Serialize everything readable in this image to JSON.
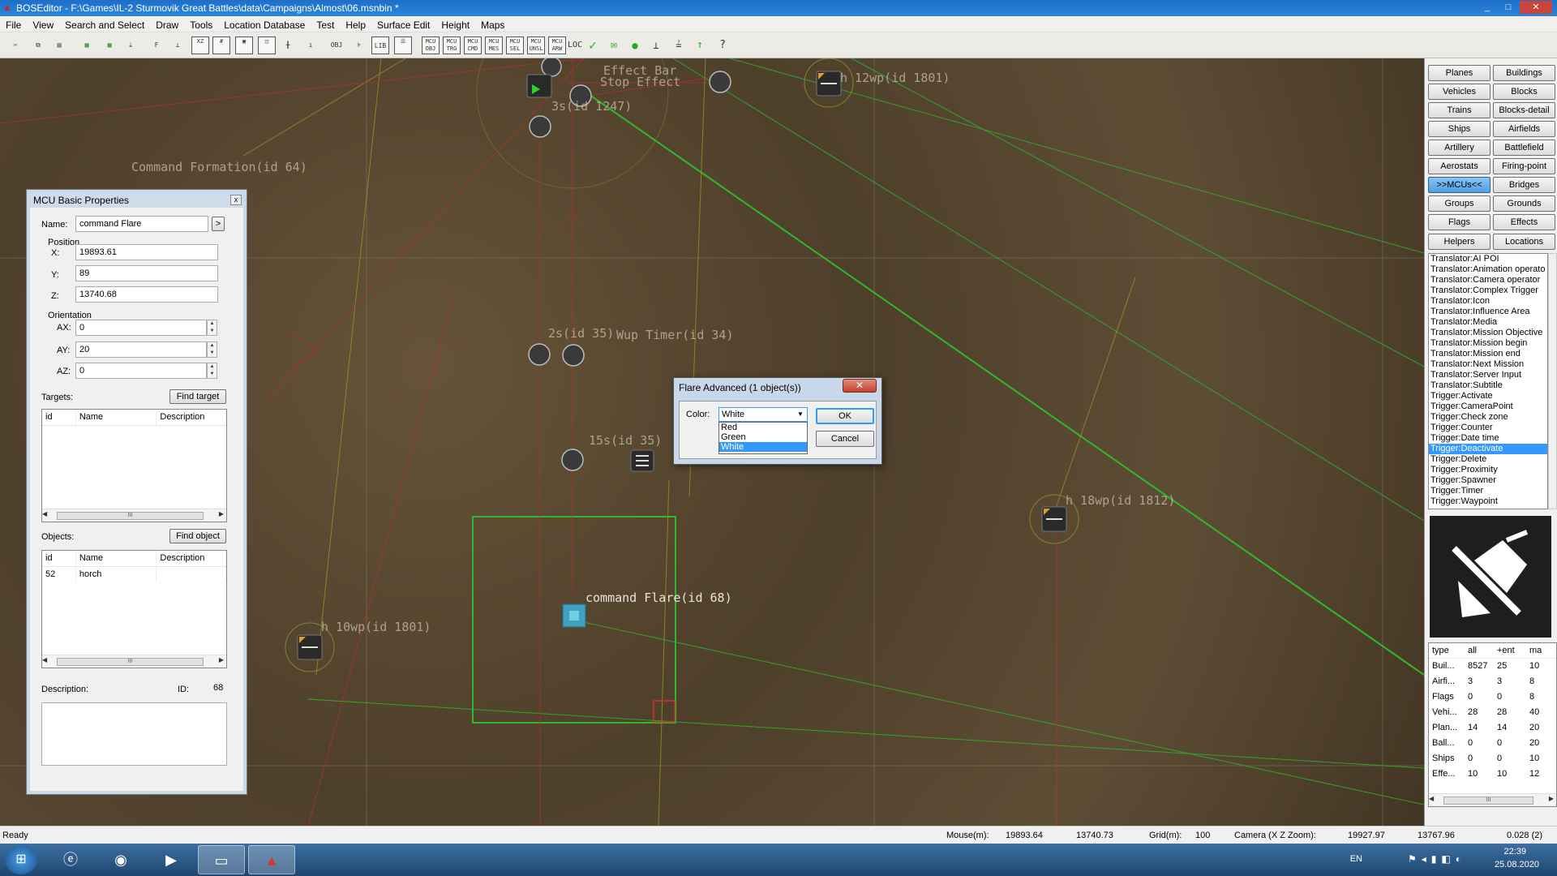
{
  "window": {
    "title": "BOSEditor - F:\\Games\\IL-2 Sturmovik Great Battles\\data\\Campaigns\\Almost\\06.msnbin *",
    "minimize": "_",
    "maximize": "□",
    "close": "✕"
  },
  "menu": [
    "File",
    "View",
    "Search and Select",
    "Draw",
    "Tools",
    "Location Database",
    "Test",
    "Help",
    "Surface Edit",
    "Height",
    "Maps"
  ],
  "toolbar": {
    "items": [
      "OBJ FLT",
      "LIB",
      "MCU OBJ",
      "MCU TRG",
      "MCU CMD",
      "MCU MES",
      "MCU SEL",
      "MCU UNSL",
      "MCU ARW",
      "LOC"
    ]
  },
  "map": {
    "labels": [
      {
        "text": "Command Formation(id 64)"
      },
      {
        "text": "h 12wp(id 1801)"
      },
      {
        "text": "h 18wp(id 1812)"
      },
      {
        "text": "h 10wp(id 1801)"
      },
      {
        "text": "2s(id 35)"
      },
      {
        "text": "Wup Timer(id 34)"
      },
      {
        "text": "15s(id 35)"
      },
      {
        "text": "3s(id 1247)"
      },
      {
        "text": "Stop Effect"
      },
      {
        "text": "Effect Bar"
      },
      {
        "text": "command Flare(id 68)"
      }
    ]
  },
  "mcu_panel": {
    "title": "MCU Basic Properties",
    "close": "x",
    "name_label": "Name:",
    "name_value": "command Flare",
    "name_btn": ">",
    "position_label": "Position",
    "x_label": "X:",
    "x_value": "19893.61",
    "y_label": "Y:",
    "y_value": "89",
    "z_label": "Z:",
    "z_value": "13740.68",
    "orientation_label": "Orientation",
    "ax_label": "AX:",
    "ax_value": "0",
    "ay_label": "AY:",
    "ay_value": "20",
    "az_label": "AZ:",
    "az_value": "0",
    "targets_label": "Targets:",
    "find_target": "Find target",
    "objects_label": "Objects:",
    "find_object": "Find object",
    "col_id": "id",
    "col_name": "Name",
    "col_desc": "Description",
    "objects_rows": [
      {
        "id": "52",
        "name": "horch",
        "desc": ""
      }
    ],
    "description_label": "Description:",
    "id_label": "ID:",
    "id_value": "68",
    "scroll_thumb": "III"
  },
  "dialog": {
    "title": "Flare Advanced (1 object(s))",
    "close": "✕",
    "color_label": "Color:",
    "color_value": "White",
    "options": [
      "Red",
      "Green",
      "White"
    ],
    "selected": "White",
    "ok": "OK",
    "cancel": "Cancel"
  },
  "right_panel": {
    "buttons": [
      [
        "Planes",
        "Buildings"
      ],
      [
        "Vehicles",
        "Blocks"
      ],
      [
        "Trains",
        "Blocks-detail"
      ],
      [
        "Ships",
        "Airfields"
      ],
      [
        "Artillery",
        "Battlefield"
      ],
      [
        "Aerostats",
        "Firing-point"
      ],
      [
        ">>MCUs<<",
        "Bridges"
      ],
      [
        "Groups",
        "Grounds"
      ],
      [
        "Flags",
        "Effects"
      ],
      [
        "Helpers",
        "Locations"
      ]
    ],
    "selected_button": ">>MCUs<<",
    "list": [
      "Translator:AI POI",
      "Translator:Animation operato",
      "Translator:Camera operator",
      "Translator:Complex Trigger",
      "Translator:Icon",
      "Translator:Influence Area",
      "Translator:Media",
      "Translator:Mission Objective",
      "Translator:Mission begin",
      "Translator:Mission end",
      "Translator:Next Mission",
      "Translator:Server Input",
      "Translator:Subtitle",
      "Trigger:Activate",
      "Trigger:CameraPoint",
      "Trigger:Check zone",
      "Trigger:Counter",
      "Trigger:Date time",
      "Trigger:Deactivate",
      "Trigger:Delete",
      "Trigger:Proximity",
      "Trigger:Spawner",
      "Trigger:Timer",
      "Trigger:Waypoint"
    ],
    "selected_item": "Trigger:Deactivate",
    "stats_header": [
      "type",
      "all",
      "+ent",
      "ma"
    ],
    "stats_rows": [
      [
        "Buil...",
        "8527",
        "25",
        "10"
      ],
      [
        "Airfi...",
        "3",
        "3",
        "8"
      ],
      [
        "Flags",
        "0",
        "0",
        "8"
      ],
      [
        "Vehi...",
        "28",
        "28",
        "40"
      ],
      [
        "Plan...",
        "14",
        "14",
        "20"
      ],
      [
        "Ball...",
        "0",
        "0",
        "20"
      ],
      [
        "Ships",
        "0",
        "0",
        "10"
      ],
      [
        "Effe...",
        "10",
        "10",
        "12"
      ]
    ],
    "scroll_thumb": "III"
  },
  "status": {
    "ready": "Ready",
    "mouse_label": "Mouse(m):",
    "mouse_x": "19893.64",
    "mouse_z": "13740.73",
    "grid_label": "Grid(m):",
    "grid_value": "100",
    "camera_label": "Camera (X Z Zoom):",
    "cam_x": "19927.97",
    "cam_z": "13767.96",
    "cam_zoom": "0.028 (2)"
  },
  "taskbar": {
    "lang": "EN",
    "time": "22:39",
    "date": "25.08.2020"
  }
}
